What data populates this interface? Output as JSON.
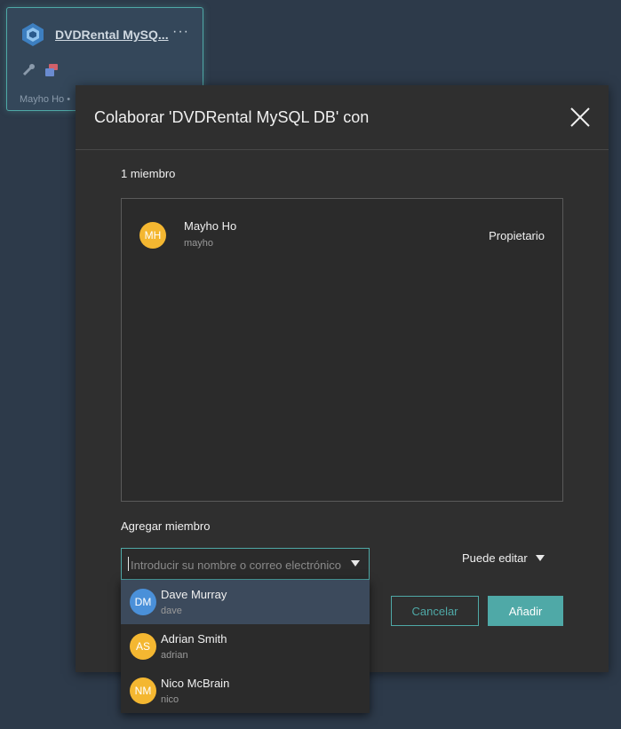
{
  "project_card": {
    "title": "DVDRental MySQ...",
    "more": "···",
    "owner": "Mayho Ho •"
  },
  "dialog": {
    "title": "Colaborar 'DVDRental MySQL DB' con",
    "member_count": "1 miembro",
    "members": [
      {
        "initials": "MH",
        "name": "Mayho Ho",
        "username": "mayho",
        "role": "Propietario",
        "color": "#f4b731"
      }
    ],
    "add_member_label": "Agregar miembro",
    "search_placeholder": "Introducir su nombre o correo electrónico",
    "permission": "Puede editar",
    "cancel_label": "Cancelar",
    "add_label": "Añadir"
  },
  "suggestions": [
    {
      "initials": "DM",
      "name": "Dave Murray",
      "username": "dave",
      "color": "#4a90d9",
      "active": true
    },
    {
      "initials": "AS",
      "name": "Adrian Smith",
      "username": "adrian",
      "color": "#f4b731",
      "active": false
    },
    {
      "initials": "NM",
      "name": "Nico McBrain",
      "username": "nico",
      "color": "#f4b731",
      "active": false
    }
  ],
  "colors": {
    "accent": "#4fa9a7",
    "background": "#2d3a4a",
    "dialog": "#2f2f2f"
  }
}
